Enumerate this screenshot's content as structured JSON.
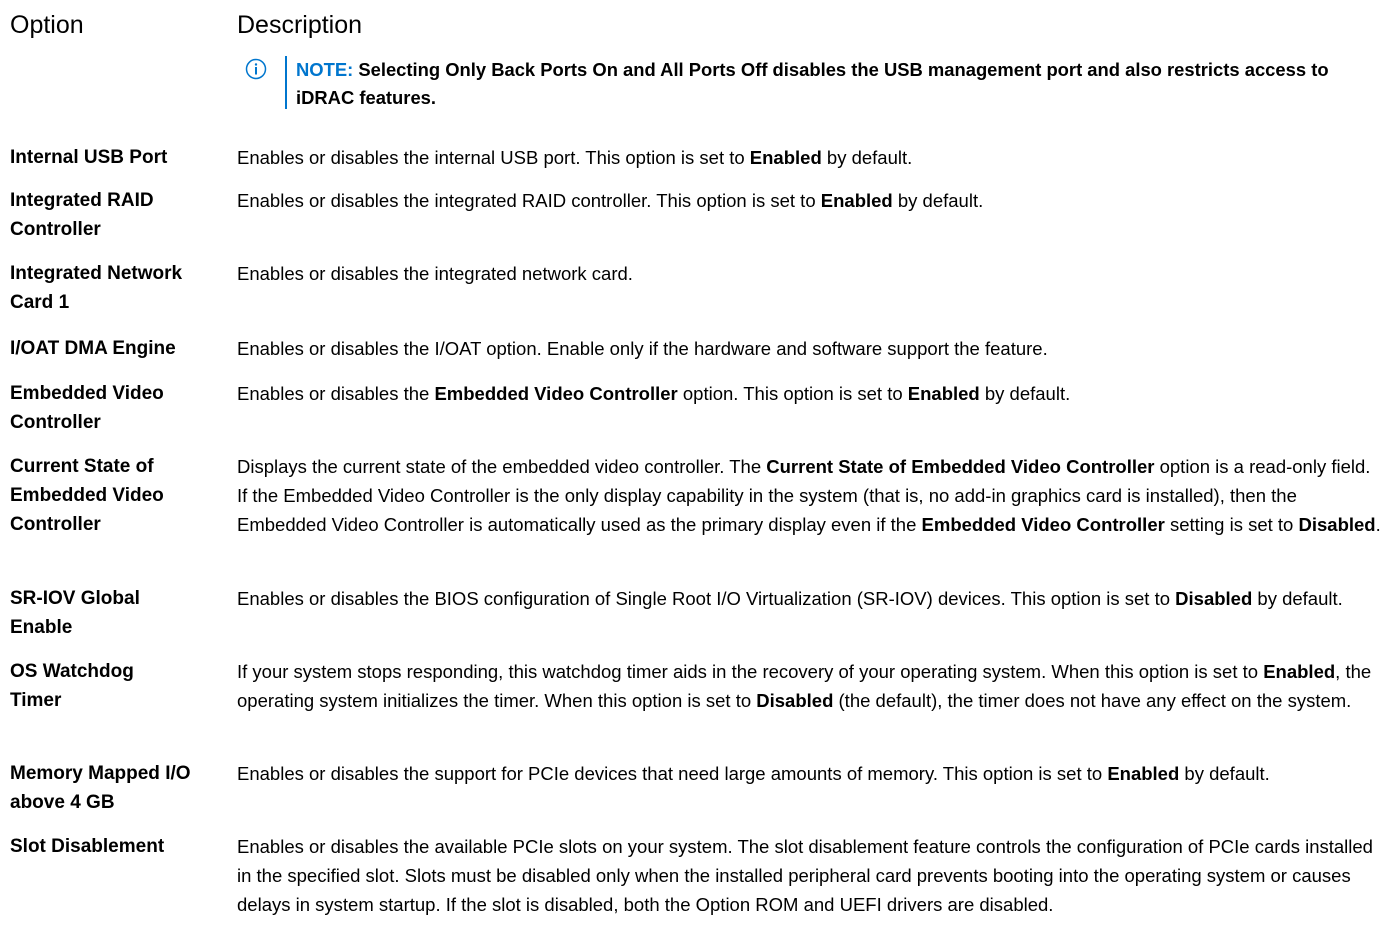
{
  "header": {
    "option": "Option",
    "description": "Description"
  },
  "note": {
    "icon": "info-icon",
    "color": "#0076ce",
    "label": "NOTE:",
    "text": "Selecting Only Back Ports On and All Ports Off disables the USB management port and also restricts access to iDRAC features."
  },
  "rows": [
    {
      "option": "Internal USB Port",
      "description": [
        {
          "t": "Enables or disables the internal USB port. This option is set to "
        },
        {
          "t": "Enabled",
          "b": true
        },
        {
          "t": " by default."
        }
      ]
    },
    {
      "option": "Integrated RAID Controller",
      "description": [
        {
          "t": "Enables or disables the integrated RAID controller. This option is set to "
        },
        {
          "t": "Enabled",
          "b": true
        },
        {
          "t": " by default."
        }
      ]
    },
    {
      "option": "Integrated Network Card 1",
      "description": [
        {
          "t": "Enables or disables the integrated network card."
        }
      ]
    },
    {
      "option": "I/OAT DMA Engine",
      "description": [
        {
          "t": "Enables or disables the I/OAT option. Enable only if the hardware and software support the feature."
        }
      ]
    },
    {
      "option": "Embedded Video Controller",
      "description": [
        {
          "t": "Enables or disables the "
        },
        {
          "t": "Embedded Video Controller",
          "b": true
        },
        {
          "t": " option. This option is set to "
        },
        {
          "t": "Enabled",
          "b": true
        },
        {
          "t": " by default."
        }
      ]
    },
    {
      "option": "Current State of Embedded Video Controller",
      "description": [
        {
          "t": "Displays the current state of the embedded video controller. The "
        },
        {
          "t": "Current State of Embedded Video Controller",
          "b": true
        },
        {
          "t": " option is a read-only field. If the Embedded Video Controller is the only display capability in the system (that is, no add-in graphics card is installed), then the Embedded Video Controller is automatically used as the primary display even if the "
        },
        {
          "t": "Embedded Video Controller",
          "b": true
        },
        {
          "t": " setting is set to "
        },
        {
          "t": "Disabled",
          "b": true
        },
        {
          "t": "."
        }
      ]
    },
    {
      "option": "SR-IOV Global Enable",
      "description": [
        {
          "t": "Enables or disables the BIOS configuration of Single Root I/O Virtualization (SR-IOV) devices. This option is set to "
        },
        {
          "t": "Disabled",
          "b": true
        },
        {
          "t": " by default."
        }
      ]
    },
    {
      "option": "OS Watchdog Timer",
      "description": [
        {
          "t": "If your system stops responding, this watchdog timer aids in the recovery of your operating system. When this option is set to "
        },
        {
          "t": "Enabled",
          "b": true
        },
        {
          "t": ", the operating system initializes the timer. When this option is set to "
        },
        {
          "t": "Disabled",
          "b": true
        },
        {
          "t": " (the default), the timer does not have any effect on the system."
        }
      ]
    },
    {
      "option": "Memory Mapped I/O above 4 GB",
      "description": [
        {
          "t": "Enables or disables the support for PCIe devices that need large amounts of memory. This option is set to "
        },
        {
          "t": "Enabled",
          "b": true
        },
        {
          "t": " by default."
        }
      ]
    },
    {
      "option": "Slot Disablement",
      "description": [
        {
          "t": "Enables or disables the available PCIe slots on your system. The slot disablement feature controls the configuration of PCIe cards installed in the specified slot. Slots must be disabled only when the installed peripheral card prevents booting into the operating system or causes delays in system startup. If the slot is disabled, both the Option ROM and UEFI drivers are disabled."
        }
      ]
    }
  ]
}
